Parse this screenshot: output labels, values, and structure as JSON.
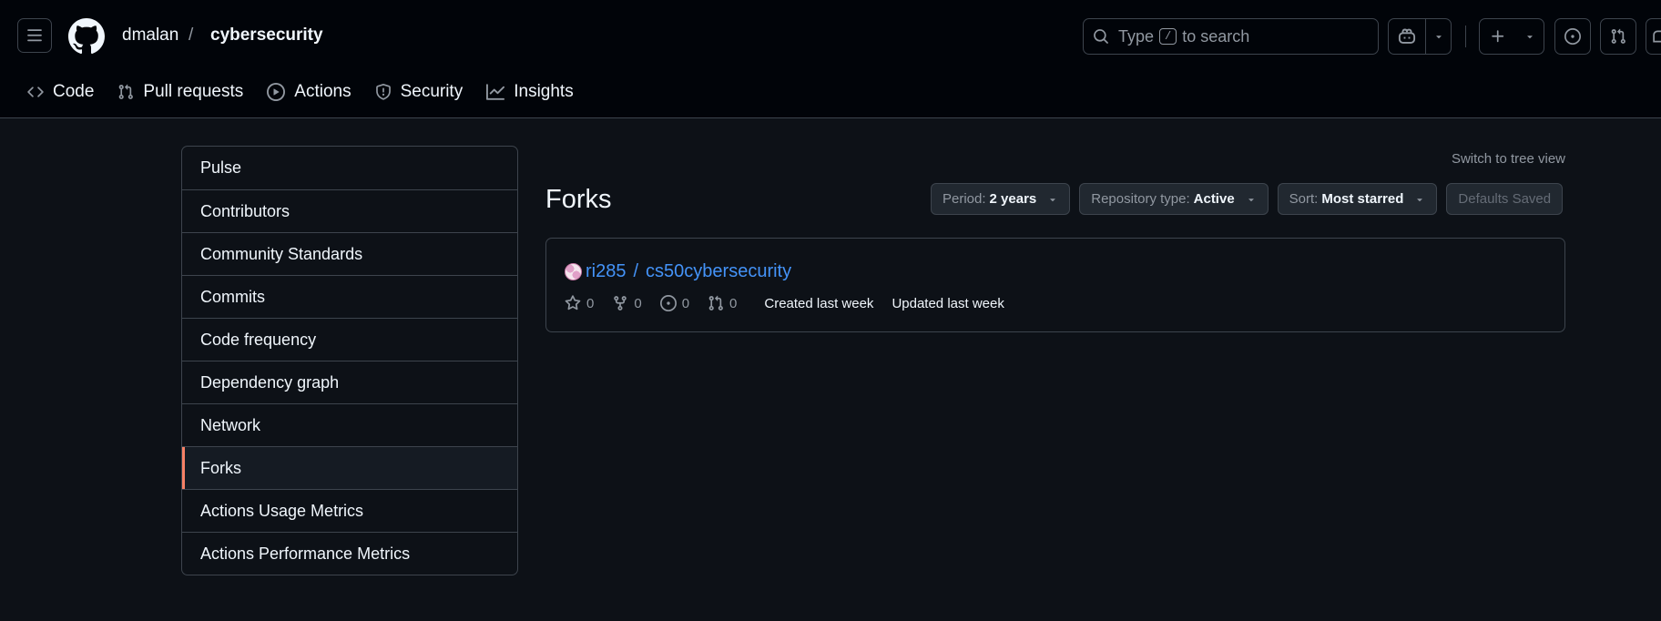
{
  "header": {
    "owner": "dmalan",
    "separator": "/",
    "repo": "cybersecurity",
    "search": {
      "prefix": "Type",
      "key": "/",
      "suffix": "to search"
    }
  },
  "nav": [
    {
      "label": "Code",
      "icon": "code-icon"
    },
    {
      "label": "Pull requests",
      "icon": "git-pull-request-icon"
    },
    {
      "label": "Actions",
      "icon": "play-icon"
    },
    {
      "label": "Security",
      "icon": "shield-icon"
    },
    {
      "label": "Insights",
      "icon": "graph-icon"
    }
  ],
  "sidebar": {
    "items": [
      {
        "label": "Pulse"
      },
      {
        "label": "Contributors"
      },
      {
        "label": "Community Standards"
      },
      {
        "label": "Commits"
      },
      {
        "label": "Code frequency"
      },
      {
        "label": "Dependency graph"
      },
      {
        "label": "Network"
      },
      {
        "label": "Forks",
        "selected": true
      },
      {
        "label": "Actions Usage Metrics"
      },
      {
        "label": "Actions Performance Metrics"
      }
    ]
  },
  "main": {
    "switch_link": "Switch to tree view",
    "title": "Forks",
    "filters": {
      "period": {
        "label": "Period:",
        "value": "2 years"
      },
      "repo_type": {
        "label": "Repository type:",
        "value": "Active"
      },
      "sort": {
        "label": "Sort:",
        "value": "Most starred"
      },
      "defaults_saved": "Defaults Saved"
    },
    "fork": {
      "owner": "ri285",
      "separator": "/",
      "name": "cs50cybersecurity",
      "stars": "0",
      "forks": "0",
      "issues": "0",
      "pulls": "0",
      "created": "Created last week",
      "updated": "Updated last week"
    }
  },
  "colors": {
    "background": "#0d1117",
    "header_background": "#010409",
    "link": "#4493f8",
    "selected_accent": "#f78166"
  }
}
